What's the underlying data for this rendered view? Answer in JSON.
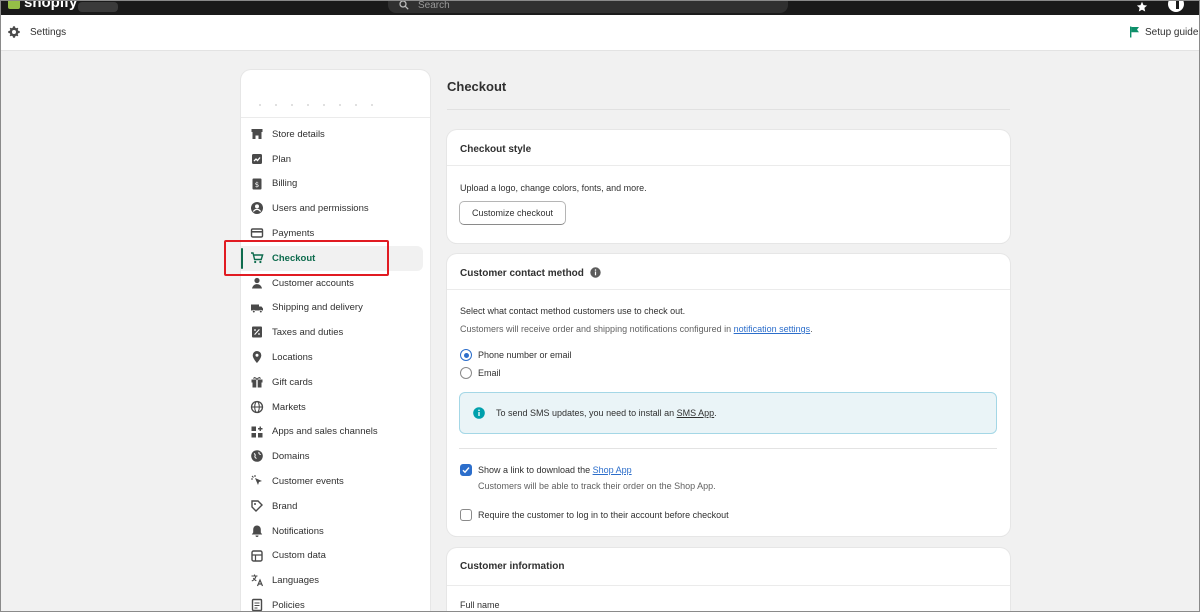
{
  "topbar": {
    "brand": "shopify",
    "search_placeholder": "Search"
  },
  "header": {
    "title": "Settings",
    "setup_guide": "Setup guide"
  },
  "sidebar": {
    "items": [
      {
        "label": "Store details",
        "icon": "store-icon"
      },
      {
        "label": "Plan",
        "icon": "plan-icon"
      },
      {
        "label": "Billing",
        "icon": "billing-icon"
      },
      {
        "label": "Users and permissions",
        "icon": "user-circle-icon"
      },
      {
        "label": "Payments",
        "icon": "payments-icon"
      },
      {
        "label": "Checkout",
        "icon": "cart-icon",
        "active": true
      },
      {
        "label": "Customer accounts",
        "icon": "person-icon"
      },
      {
        "label": "Shipping and delivery",
        "icon": "truck-icon"
      },
      {
        "label": "Taxes and duties",
        "icon": "percent-icon"
      },
      {
        "label": "Locations",
        "icon": "location-pin-icon"
      },
      {
        "label": "Gift cards",
        "icon": "gift-icon"
      },
      {
        "label": "Markets",
        "icon": "globe-icon"
      },
      {
        "label": "Apps and sales channels",
        "icon": "apps-icon"
      },
      {
        "label": "Domains",
        "icon": "domain-globe-icon"
      },
      {
        "label": "Customer events",
        "icon": "cursor-icon"
      },
      {
        "label": "Brand",
        "icon": "brand-icon"
      },
      {
        "label": "Notifications",
        "icon": "bell-icon"
      },
      {
        "label": "Custom data",
        "icon": "database-icon"
      },
      {
        "label": "Languages",
        "icon": "translate-icon"
      },
      {
        "label": "Policies",
        "icon": "policy-icon"
      }
    ]
  },
  "main": {
    "title": "Checkout",
    "checkout_style": {
      "heading": "Checkout style",
      "description": "Upload a logo, change colors, fonts, and more.",
      "button": "Customize checkout"
    },
    "contact_method": {
      "heading": "Customer contact method",
      "description": "Select what contact method customers use to check out.",
      "note_prefix": "Customers will receive order and shipping notifications configured in ",
      "note_link": "notification settings",
      "note_suffix": ".",
      "options": [
        {
          "label": "Phone number or email",
          "selected": true
        },
        {
          "label": "Email",
          "selected": false
        }
      ],
      "banner_prefix": "To send SMS updates, you need to install an ",
      "banner_link": "SMS App",
      "banner_suffix": ".",
      "shop_app_prefix": "Show a link to download the ",
      "shop_app_link": "Shop App",
      "shop_app_checked": true,
      "shop_app_help": "Customers will be able to track their order on the Shop App.",
      "require_login": "Require the customer to log in to their account before checkout",
      "require_login_checked": false
    },
    "customer_info": {
      "heading": "Customer information",
      "field_label": "Full name"
    }
  },
  "colors": {
    "accent": "#0d6b4d",
    "link": "#2c6ecb",
    "highlight": "#e11b22"
  }
}
